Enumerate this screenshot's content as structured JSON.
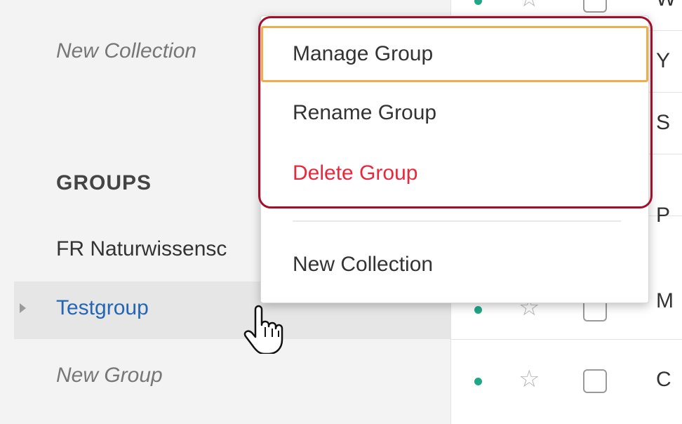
{
  "sidebar": {
    "new_collection": "New Collection",
    "groups_heading": "GROUPS",
    "groups": [
      {
        "label": "FR Naturwissensc"
      },
      {
        "label": "Testgroup",
        "selected": true
      }
    ],
    "new_group": "New Group"
  },
  "list": {
    "rows": [
      {
        "letter": "W"
      },
      {
        "letter": "Y"
      },
      {
        "letter": "S"
      },
      {
        "letter": "P"
      },
      {
        "letter": "M"
      },
      {
        "letter": "C"
      }
    ]
  },
  "context_menu": {
    "items": [
      {
        "label": "Manage Group",
        "focused": true
      },
      {
        "label": "Rename Group"
      },
      {
        "label": "Delete Group",
        "danger": true
      },
      {
        "label": "New Collection"
      }
    ]
  },
  "colors": {
    "accent_link": "#2366b5",
    "danger": "#e8283c",
    "focus_outline": "#f0ad4e",
    "highlight_box": "#a0102c",
    "status_dot": "#1fa886"
  },
  "icons": {
    "expander": "triangle-right-icon",
    "star": "star-outline-icon",
    "cursor": "hand-pointer-cursor"
  }
}
